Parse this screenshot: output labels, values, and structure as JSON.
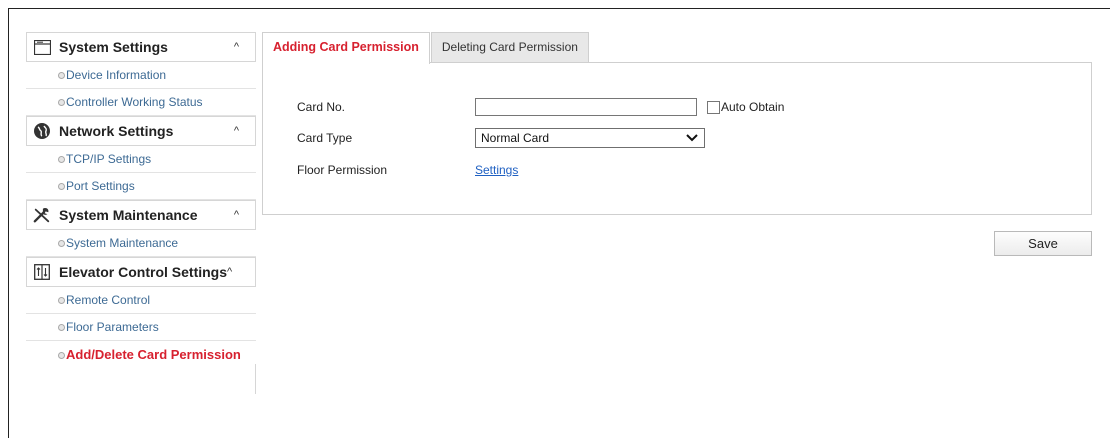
{
  "sidebar": {
    "sections": [
      {
        "title": "System Settings",
        "icon": "window-icon",
        "items": [
          "Device Information",
          "Controller Working Status"
        ]
      },
      {
        "title": "Network Settings",
        "icon": "globe-icon",
        "items": [
          "TCP/IP Settings",
          "Port Settings"
        ]
      },
      {
        "title": "System Maintenance",
        "icon": "tools-icon",
        "items": [
          "System Maintenance"
        ]
      },
      {
        "title": "Elevator Control Settings",
        "icon": "elevator-icon",
        "items": [
          "Remote Control",
          "Floor Parameters",
          "Add/Delete Card Permission"
        ]
      }
    ],
    "caret": "^",
    "active_item": "Add/Delete Card Permission"
  },
  "tabs": [
    {
      "label": "Adding Card Permission",
      "active": true
    },
    {
      "label": "Deleting Card Permission",
      "active": false
    }
  ],
  "form": {
    "card_no_label": "Card No.",
    "card_no_value": "",
    "auto_obtain_label": "Auto Obtain",
    "auto_obtain_checked": false,
    "card_type_label": "Card Type",
    "card_type_value": "Normal Card",
    "floor_permission_label": "Floor Permission",
    "floor_permission_link": "Settings"
  },
  "save_label": "Save",
  "colors": {
    "active_red": "#d7212f",
    "link_blue": "#1f60c2",
    "menu_item_blue": "#3d6a94"
  }
}
